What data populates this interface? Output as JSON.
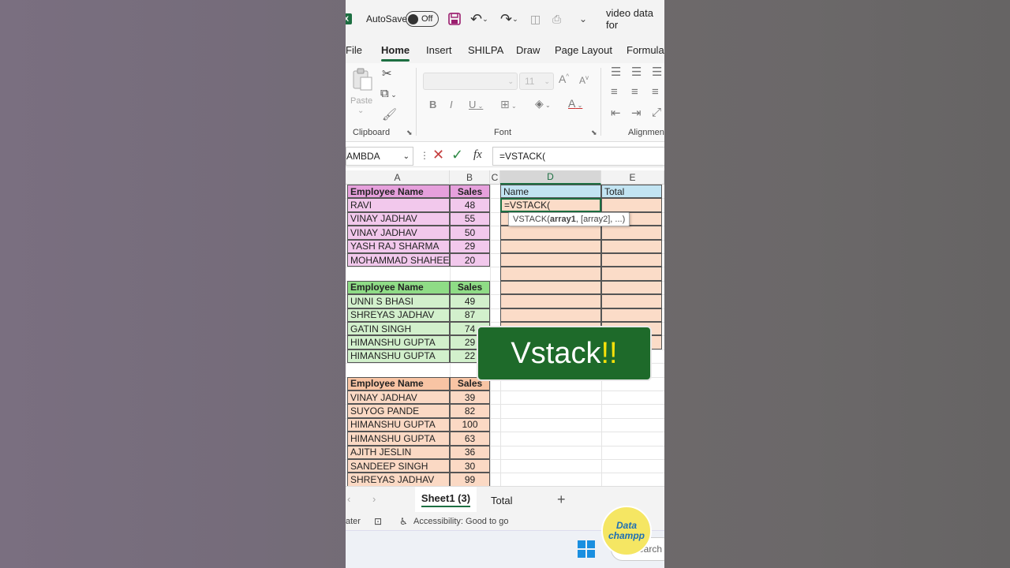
{
  "titlebar": {
    "app_icon": "X",
    "autosave_label": "AutoSave",
    "autosave_state": "Off",
    "filename": "video data for"
  },
  "menu": [
    "File",
    "Home",
    "Insert",
    "SHILPA",
    "Draw",
    "Page Layout",
    "Formula"
  ],
  "menu_active": "Home",
  "ribbon": {
    "paste_label": "Paste",
    "font_size": "11",
    "groups": [
      "Clipboard",
      "Font",
      "Alignment"
    ]
  },
  "formula_bar": {
    "name_box": "AMBDA",
    "fx_label": "fx",
    "formula": "=VSTACK("
  },
  "columns": [
    "A",
    "B",
    "C",
    "D",
    "E"
  ],
  "tables": [
    {
      "color": "#f2c8ec",
      "header_color": "#e6a0dc",
      "headers": [
        "Employee Name",
        "Sales"
      ],
      "rows": [
        [
          "RAVI",
          "48"
        ],
        [
          "VINAY JADHAV",
          "55"
        ],
        [
          "VINAY JADHAV",
          "50"
        ],
        [
          "YASH RAJ SHARMA",
          "29"
        ],
        [
          "MOHAMMAD SHAHEEN",
          "20"
        ]
      ]
    },
    {
      "color": "#d2f0cc",
      "header_color": "#8fdc86",
      "headers": [
        "Employee Name",
        "Sales"
      ],
      "rows": [
        [
          "UNNI S BHASI",
          "49"
        ],
        [
          "SHREYAS JADHAV",
          "87"
        ],
        [
          "GATIN SINGH",
          "74"
        ],
        [
          "HIMANSHU GUPTA",
          "29"
        ],
        [
          "HIMANSHU GUPTA",
          "22"
        ]
      ]
    },
    {
      "color": "#fbd9c4",
      "header_color": "#f8c4a4",
      "headers": [
        "Employee Name",
        "Sales"
      ],
      "rows": [
        [
          "VINAY JADHAV",
          "39"
        ],
        [
          "SUYOG PANDE",
          "82"
        ],
        [
          "HIMANSHU GUPTA",
          "100"
        ],
        [
          "HIMANSHU GUPTA",
          "63"
        ],
        [
          "AJITH JESLIN",
          "36"
        ],
        [
          "SANDEEP SINGH",
          "30"
        ],
        [
          "SHREYAS JADHAV",
          "99"
        ]
      ]
    }
  ],
  "output": {
    "headers": [
      "Name",
      "Total"
    ],
    "header_color": "#c2e4f2",
    "body_color": "#fbdcc8",
    "active_cell_text": "=VSTACK("
  },
  "tooltip": {
    "fn": "VSTACK(",
    "arg1": "array1",
    "rest": ", [array2], ...)"
  },
  "overlay": {
    "text": "Vstack",
    "bang": "!!"
  },
  "sheets": {
    "tabs": [
      "Sheet1 (3)",
      "Total"
    ],
    "active": "Sheet1 (3)",
    "add": "+"
  },
  "status": {
    "left": "ater",
    "accessibility": "Accessibility: Good to go"
  },
  "taskbar": {
    "search": "Search"
  },
  "logo": {
    "line1": "Data",
    "line2": "champp"
  },
  "accent": "#1d6f42"
}
